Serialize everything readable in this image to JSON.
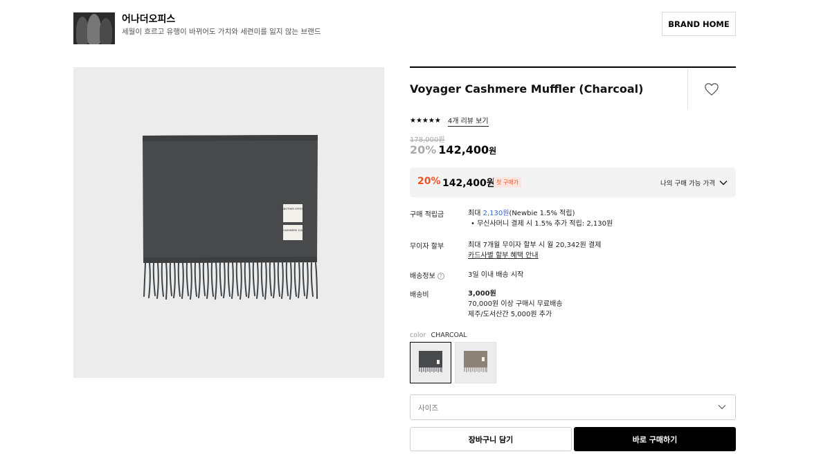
{
  "brand": {
    "name": "어나더오피스",
    "slogan": "세월이 흐르고 유행이 바뀌어도 가치와 세련미를 잃지 않는 브랜드",
    "home_button": "BRAND HOME"
  },
  "product": {
    "title": "Voyager Cashmere Muffler (Charcoal)",
    "stars": "★★★★★",
    "rating": 5,
    "review_link": "4개 리뷰 보기",
    "original_price": "178,000원",
    "discount_rate": "20%",
    "sale_price": "142,400",
    "currency": "원",
    "image_label_1": "ANOTHER OFFICE",
    "image_label_2": "CASHMERE 100"
  },
  "benefit": {
    "discount_rate": "20%",
    "price": "142,400원",
    "badge": "첫 구매가",
    "my_price_label": "나의 구매 가능 가격"
  },
  "points": {
    "label": "구매 적립금",
    "max_prefix": "최대 ",
    "amount": "2,130원",
    "detail": "(Newbie 1.5% 적립)",
    "bullet": "• 무신사머니 결제 시 1.5% 추가 적립: 2,130원"
  },
  "installment": {
    "label": "무이자 할부",
    "text": "최대 7개월 무이자 할부 시 월 20,342원 결제",
    "link": "카드사별 할부 혜택 안내"
  },
  "shipping": {
    "label": "배송정보",
    "help": "?",
    "text": "3일 이내 배송 시작"
  },
  "shipping_fee": {
    "label": "배송비",
    "amount": "3,000원",
    "free_condition": "70,000원 이상 구매시 무료배송",
    "island": "제주/도서산간 5,000원 추가"
  },
  "color": {
    "label": "color",
    "value": "CHARCOAL",
    "options": [
      {
        "name": "Charcoal",
        "hex": "#4a4c4e",
        "selected": true
      },
      {
        "name": "Beige",
        "hex": "#8c8275",
        "selected": false
      }
    ]
  },
  "size": {
    "placeholder": "사이즈"
  },
  "actions": {
    "cart": "장바구니 담기",
    "buy": "바로 구매하기"
  },
  "colors": {
    "accent": "#f05123",
    "link_blue": "#3a63d8",
    "primary_button": "#000000"
  }
}
